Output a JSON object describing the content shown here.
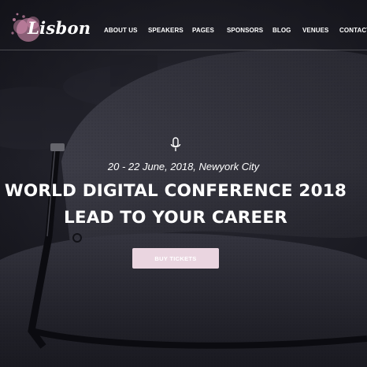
{
  "brand": {
    "name": "Lisbon",
    "accent_color": "#ea9bc0"
  },
  "nav": {
    "items": [
      {
        "label": "ABOUT US"
      },
      {
        "label": "SPEAKERS"
      },
      {
        "label": "PAGES"
      },
      {
        "label": "SPONSORS"
      },
      {
        "label": "BLOG"
      },
      {
        "label": "VENUES"
      },
      {
        "label": "CONTACT"
      }
    ]
  },
  "hero": {
    "icon": "microphone-icon",
    "date": "20 - 22 June, 2018, Newyork City",
    "title_line1": "WORLD DIGITAL CONFERENCE 2018",
    "title_line2": "LEAD TO YOUR CAREER",
    "cta_label": "BUY TICKETS",
    "cta_color": "#ead5e0"
  }
}
